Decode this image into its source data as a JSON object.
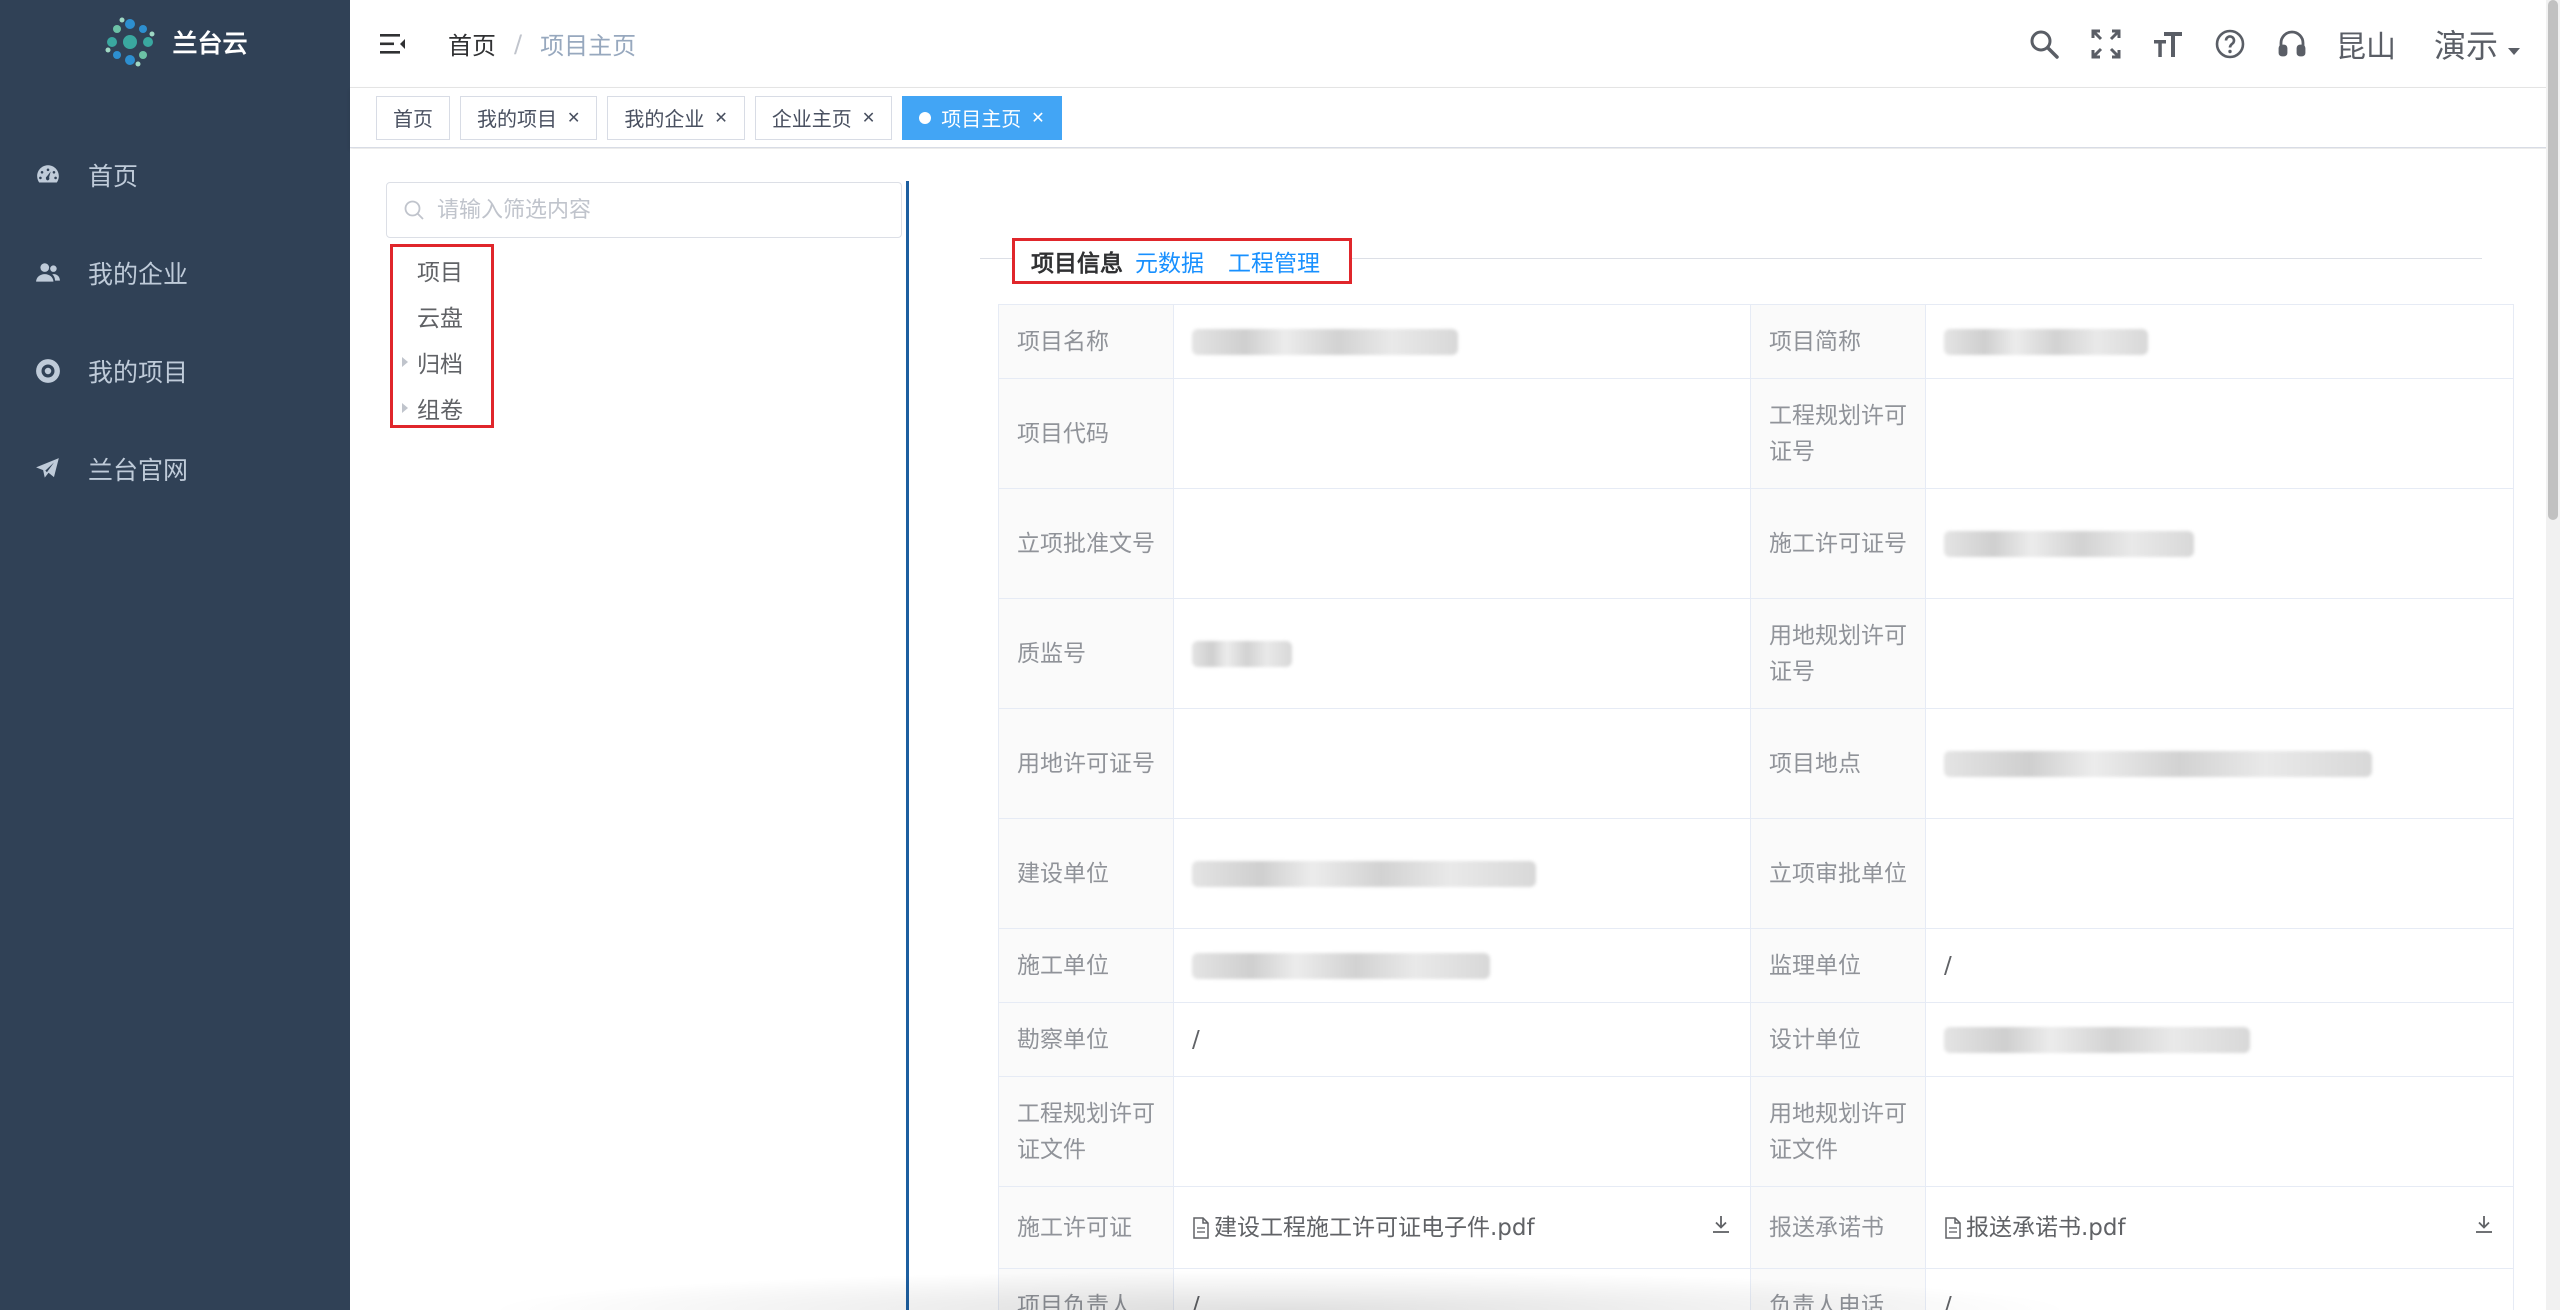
{
  "app": {
    "name": "兰台云"
  },
  "sidebar": {
    "items": [
      {
        "label": "首页",
        "icon": "dashboard-icon"
      },
      {
        "label": "我的企业",
        "icon": "peoples-icon"
      },
      {
        "label": "我的项目",
        "icon": "lifebuoy-icon"
      },
      {
        "label": "兰台官网",
        "icon": "paper-plane-icon"
      }
    ]
  },
  "navbar": {
    "breadcrumb": {
      "home": "首页",
      "separator": "/",
      "current": "项目主页"
    },
    "location": "昆山",
    "user": "演示"
  },
  "tags": [
    {
      "label": "首页",
      "closable": false,
      "active": false
    },
    {
      "label": "我的项目",
      "closable": true,
      "active": false
    },
    {
      "label": "我的企业",
      "closable": true,
      "active": false
    },
    {
      "label": "企业主页",
      "closable": true,
      "active": false
    },
    {
      "label": "项目主页",
      "closable": true,
      "active": true
    }
  ],
  "tree": {
    "placeholder": "请输入筛选内容",
    "nodes": [
      {
        "label": "项目",
        "expandable": false
      },
      {
        "label": "云盘",
        "expandable": false
      },
      {
        "label": "归档",
        "expandable": true
      },
      {
        "label": "组卷",
        "expandable": true
      }
    ]
  },
  "section": {
    "title": "项目信息",
    "links": [
      "元数据",
      "工程管理"
    ]
  },
  "info_table": {
    "rows": [
      {
        "l1": "项目名称",
        "v1": "",
        "l2": "项目简称",
        "v2": ""
      },
      {
        "l1": "项目代码",
        "v1": "",
        "l2": "工程规划许可证号",
        "v2": ""
      },
      {
        "l1": "立项批准文号",
        "v1": "",
        "l2": "施工许可证号",
        "v2": ""
      },
      {
        "l1": "质监号",
        "v1": "",
        "l2": "用地规划许可证号",
        "v2": ""
      },
      {
        "l1": "用地许可证号",
        "v1": "",
        "l2": "项目地点",
        "v2": ""
      },
      {
        "l1": "建设单位",
        "v1": "",
        "l2": "立项审批单位",
        "v2": ""
      },
      {
        "l1": "施工单位",
        "v1": "",
        "l2": "监理单位",
        "v2": "/"
      },
      {
        "l1": "勘察单位",
        "v1": "/",
        "l2": "设计单位",
        "v2": ""
      },
      {
        "l1": "工程规划许可证文件",
        "v1": "",
        "l2": "用地规划许可证文件",
        "v2": ""
      },
      {
        "l1": "施工许可证",
        "v1": "建设工程施工许可证电子件.pdf",
        "l2": "报送承诺书",
        "v2": "报送承诺书.pdf"
      },
      {
        "l1": "项目负责人",
        "v1": "/",
        "l2": "负责人电话",
        "v2": "/"
      }
    ]
  },
  "colors": {
    "sidebar_bg": "#304156",
    "active_tag": "#42a5f5",
    "link": "#1890ff",
    "highlight_box": "#e0262b",
    "divider": "#1d5fa0"
  }
}
